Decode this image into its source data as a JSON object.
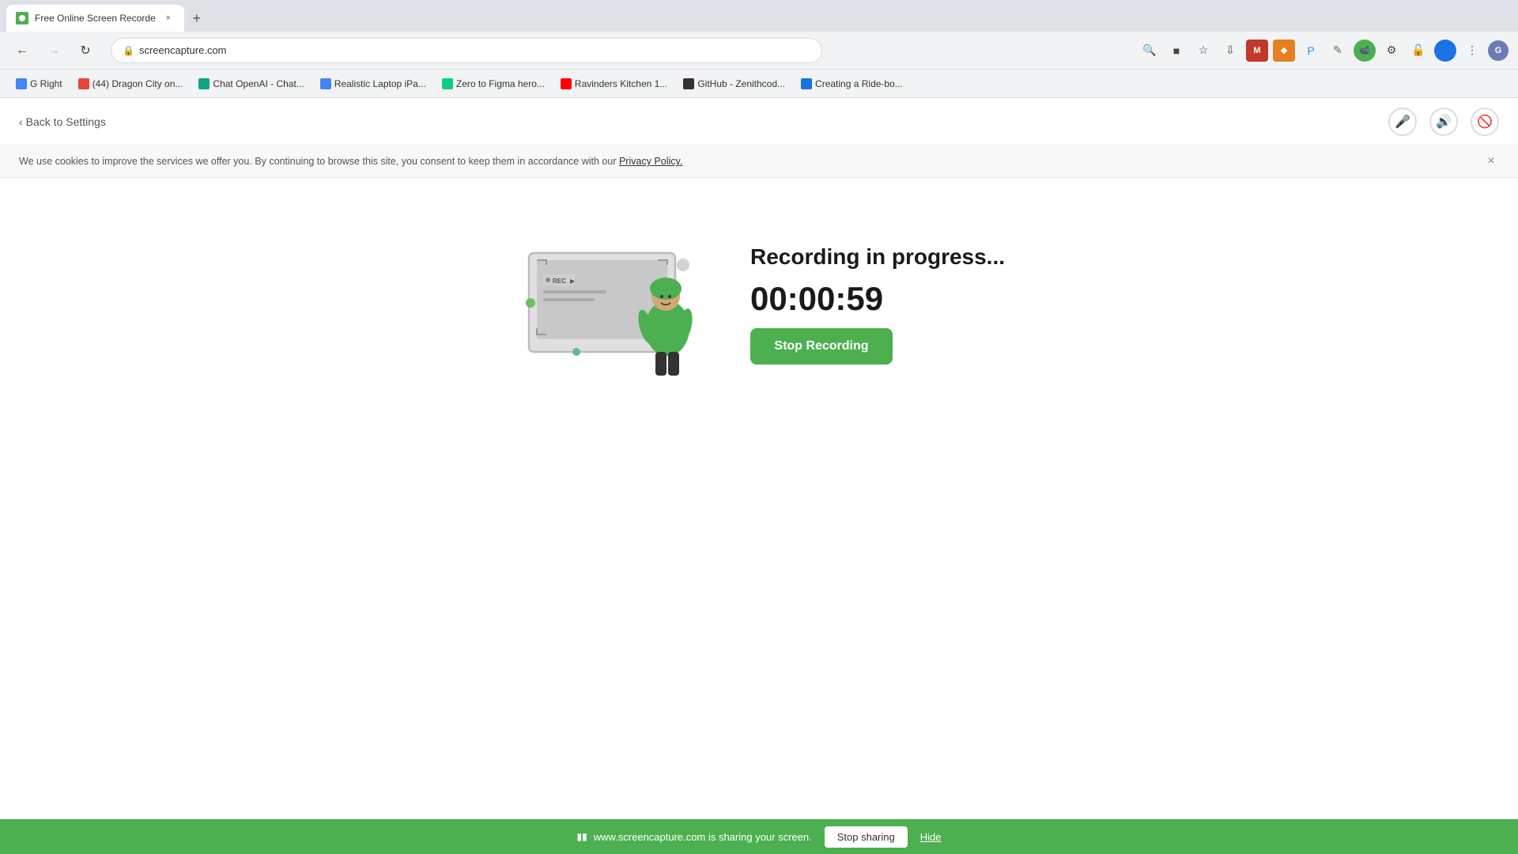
{
  "browser": {
    "tab": {
      "title": "Free Online Screen Recorde",
      "favicon_color": "#4CAF50"
    },
    "address": "screencapture.com",
    "nav": {
      "back_disabled": false,
      "forward_disabled": true
    }
  },
  "bookmarks": [
    {
      "id": "bm1",
      "label": "G Right",
      "color": "#4285f4"
    },
    {
      "id": "bm2",
      "label": "(44) Dragon City on...",
      "color": "#ea4335"
    },
    {
      "id": "bm3",
      "label": "Chat OpenAI - Chat...",
      "color": "#10a37f"
    },
    {
      "id": "bm4",
      "label": "Realistic Laptop iPa...",
      "color": "#4285f4"
    },
    {
      "id": "bm5",
      "label": "Zero to Figma hero...",
      "color": "#0acf83"
    },
    {
      "id": "bm6",
      "label": "Ravinders Kitchen 1...",
      "color": "#ff0000"
    },
    {
      "id": "bm7",
      "label": "GitHub - Zenithcod...",
      "color": "#333"
    },
    {
      "id": "bm8",
      "label": "Creating a Ride-bo...",
      "color": "#1a73e8"
    }
  ],
  "header": {
    "back_link": "Back to Settings",
    "icons": [
      "mic",
      "speaker",
      "forbidden"
    ]
  },
  "cookie_banner": {
    "text": "We use cookies to improve the services we offer you. By continuing to browse this site, you consent to keep them in accordance with our",
    "link_text": "Privacy Policy.",
    "close": "×"
  },
  "recording": {
    "status_text": "Recording in progress...",
    "timer": "00:00:59",
    "stop_button_label": "Stop Recording"
  },
  "screen_sharing": {
    "info_text": "www.screencapture.com is sharing your screen.",
    "stop_button_label": "Stop sharing",
    "hide_button_label": "Hide"
  }
}
